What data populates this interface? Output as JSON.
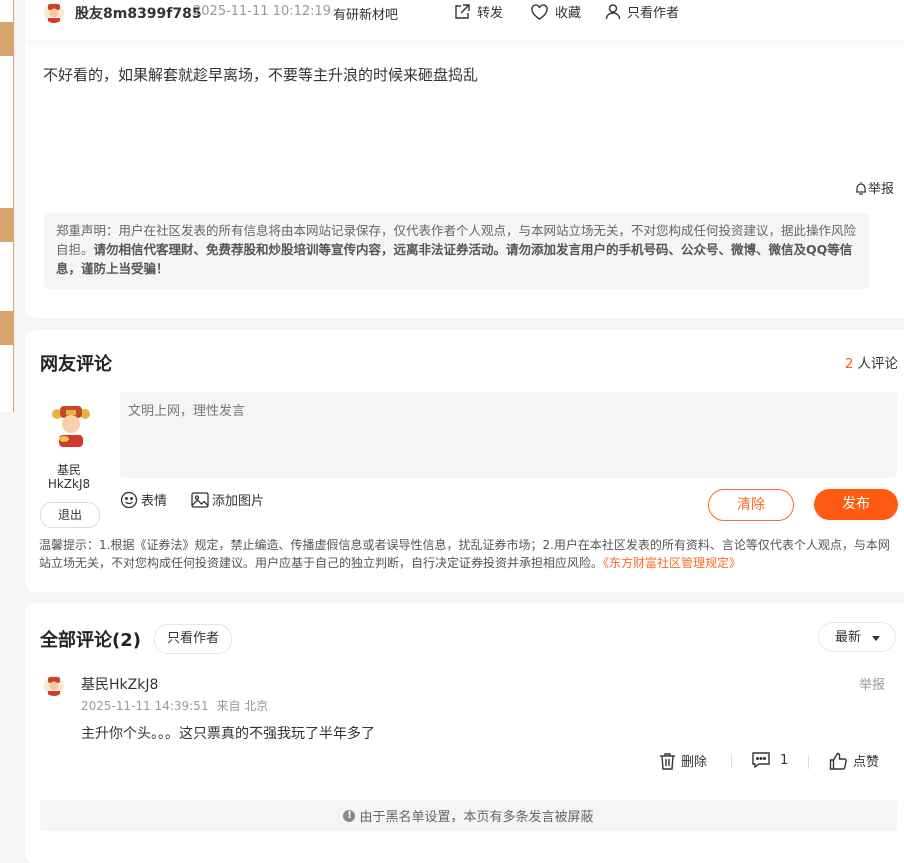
{
  "post": {
    "author": "股友8m8399f785",
    "time": "2025-11-11 10:12:19",
    "source": "有研新材吧",
    "actions": {
      "share": "转发",
      "favorite": "收藏",
      "author_only": "只看作者"
    },
    "content": "不好看的，如果解套就趁早离场，不要等主升浪的时候来砸盘捣乱",
    "report": "举报",
    "disclaimer_plain": "郑重声明：用户在社区发表的所有信息将由本网站记录保存，仅代表作者个人观点，与本网站立场无关，不对您构成任何投资建议，据此操作风险自担。",
    "disclaimer_bold": "请勿相信代客理财、免费荐股和炒股培训等宣传内容，远离非法证券活动。请勿添加发言用户的手机号码、公众号、微博、微信及QQ等信息，谨防上当受骗！"
  },
  "compose": {
    "title": "网友评论",
    "count_num": "2",
    "count_suffix": "人评论",
    "user_name": "基民HkZkJ8",
    "logout": "退出",
    "placeholder": "文明上网，理性发言",
    "emoji": "表情",
    "add_image": "添加图片",
    "clear": "清除",
    "publish": "发布",
    "tips": "温馨提示：1.根据《证券法》规定，禁止编造、传播虚假信息或者误导性信息，扰乱证券市场；2.用户在本社区发表的所有资料、言论等仅代表个人观点，与本网站立场无关，不对您构成任何投资建议。用户应基于自己的独立判断，自行决定证券投资并承担相应风险。",
    "tips_link": "《东方财富社区管理规定》"
  },
  "comments": {
    "title": "全部评论(2)",
    "author_only": "只看作者",
    "sort": "最新",
    "items": [
      {
        "user": "基民HkZkJ8",
        "time": "2025-11-11 14:39:51",
        "location": "来自 北京",
        "report": "举报",
        "text": "主升你个头。。。这只票真的不强我玩了半年多了",
        "delete": "删除",
        "reply_count": "1",
        "like": "点赞"
      }
    ],
    "blocked_notice": "由于黑名单设置，本页有多条发言被屏蔽"
  },
  "colors": {
    "accent": "#ff5a12",
    "side_tab": "#d6a56f"
  },
  "icons": [
    "share-icon",
    "heart-icon",
    "person-icon",
    "report-bell-icon",
    "emoji-icon",
    "image-icon",
    "trash-icon",
    "comment-icon",
    "thumbs-up-icon",
    "info-icon"
  ]
}
